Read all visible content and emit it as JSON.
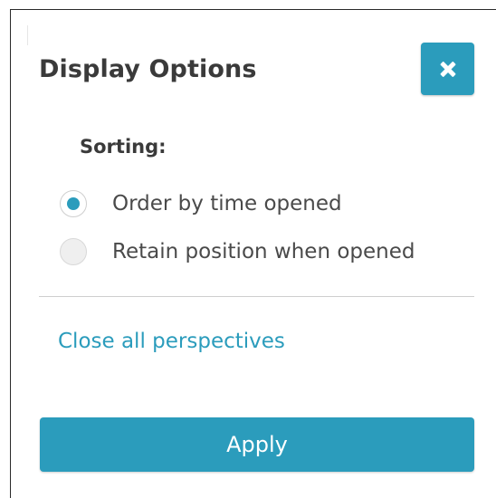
{
  "dialog": {
    "title": "Display Options",
    "close_icon": "close-icon",
    "accent_color": "#2b9cbc"
  },
  "sorting": {
    "label": "Sorting:",
    "options": [
      {
        "label": "Order by time opened",
        "checked": true
      },
      {
        "label": "Retain position when opened",
        "checked": false
      }
    ]
  },
  "actions": {
    "close_all_link": "Close all perspectives",
    "apply_label": "Apply"
  }
}
